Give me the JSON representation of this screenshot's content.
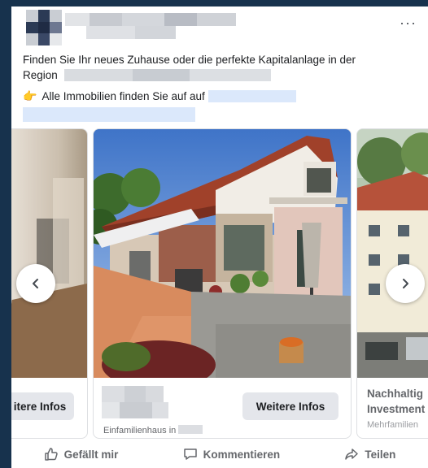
{
  "post": {
    "more_label": "···",
    "text_line1": "Finden Sie Ihr neues Zuhause oder die perfekte Kapitalanlage in der",
    "text_region": "Region",
    "text_line2": "Alle Immobilien finden Sie auf auf",
    "hand_icon": "👉"
  },
  "carousel": {
    "cards": [
      {
        "button_label": "itere Infos"
      },
      {
        "button_label": "Weitere Infos",
        "subtitle": "Einfamilienhaus in"
      },
      {
        "title_line1": "Nachhaltig",
        "title_line2": "Investment",
        "subtitle": "Mehrfamilien"
      }
    ]
  },
  "actions": {
    "like_label": "Gefällt mir",
    "comment_label": "Kommentieren",
    "share_label": "Teilen"
  },
  "colors": {
    "background": "#17324d",
    "card": "#ffffff",
    "button_bg": "#e4e6eb",
    "muted_text": "#65676b",
    "link_blur": "#dbe8fb"
  }
}
